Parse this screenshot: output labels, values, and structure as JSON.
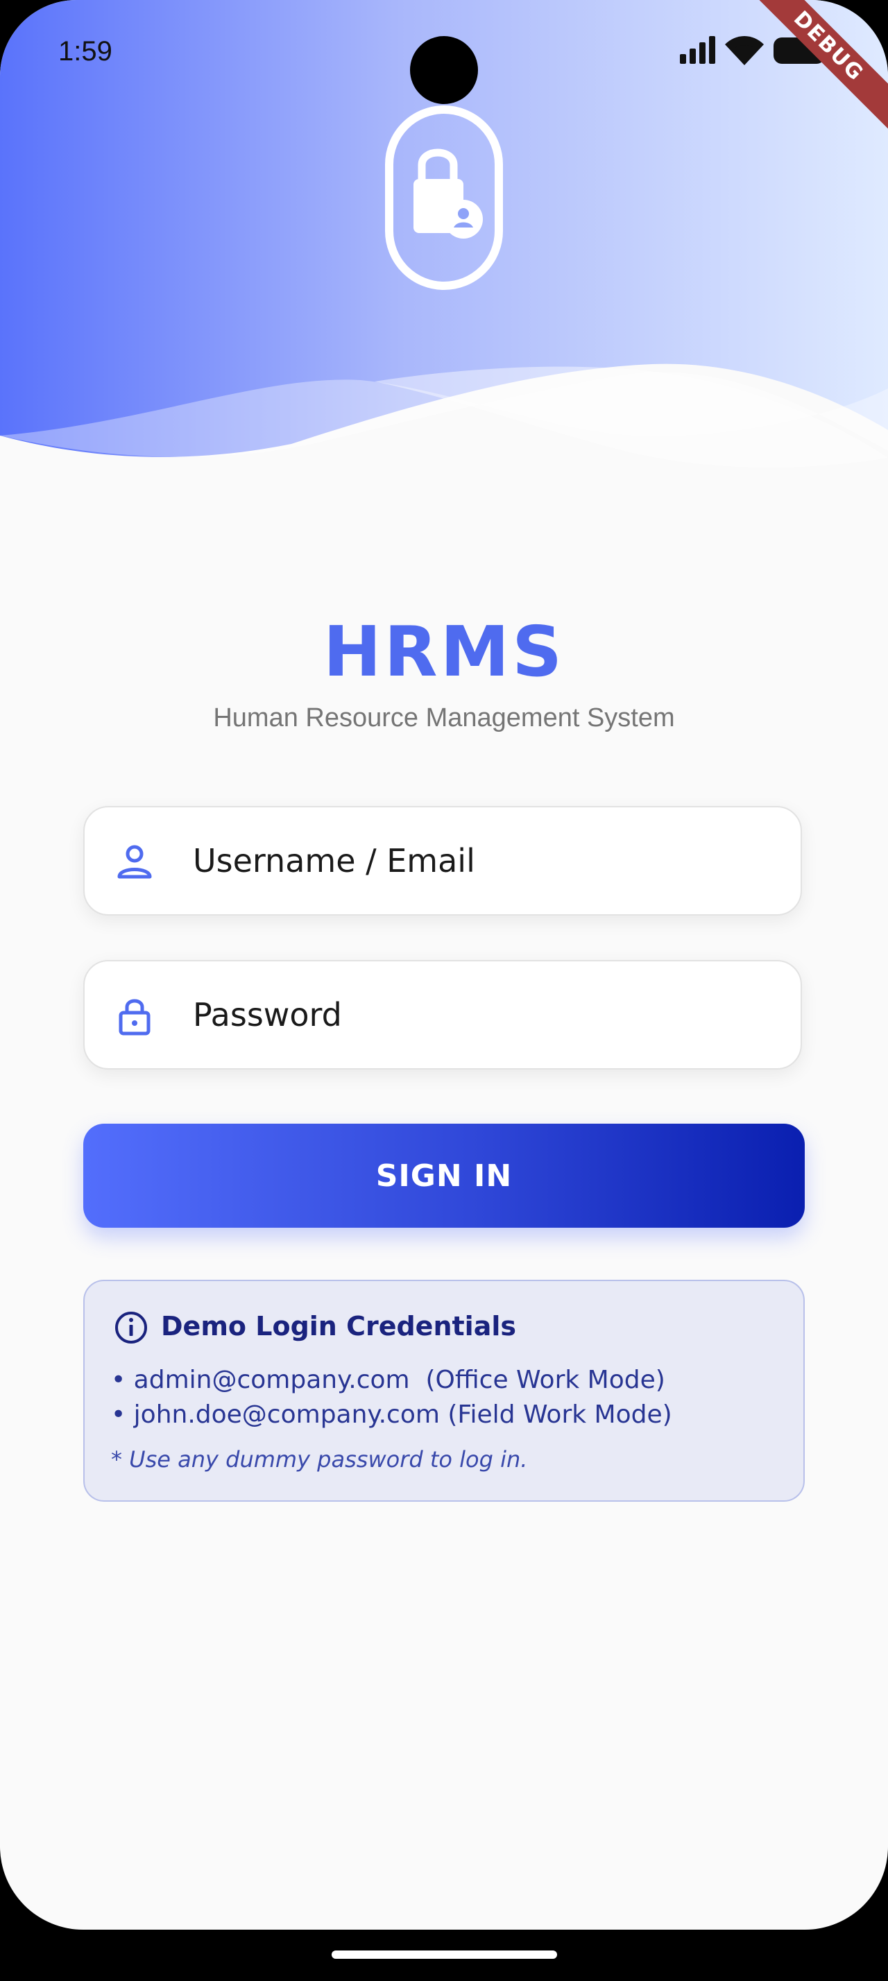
{
  "status_bar": {
    "time": "1:59",
    "icons": [
      "signal-icon",
      "wifi-icon",
      "battery-icon"
    ]
  },
  "debug_banner": {
    "label": "DEBUG"
  },
  "header": {
    "logo_icon": "lock-person-icon",
    "gradient_colors": [
      "#5a73fb",
      "#a9b7fb",
      "#dfeaff"
    ]
  },
  "app": {
    "title": "HRMS",
    "subtitle": "Human Resource Management System"
  },
  "form": {
    "username": {
      "placeholder": "Username / Email",
      "value": "",
      "icon": "person-icon"
    },
    "password": {
      "placeholder": "Password",
      "value": "",
      "icon": "lock-icon"
    },
    "sign_in_label": "SIGN IN"
  },
  "demo": {
    "icon": "info-icon",
    "title": "Demo Login Credentials",
    "lines": [
      "• admin@company.com  (Office Work Mode)",
      "• john.doe@company.com (Field Work Mode)"
    ],
    "note": "* Use any dummy password to log in."
  },
  "colors": {
    "accent": "#4f6bef",
    "button_start": "#536efc",
    "button_end": "#0a1fb0",
    "demo_bg": "#e8eaf6",
    "demo_text": "#1a237e"
  }
}
